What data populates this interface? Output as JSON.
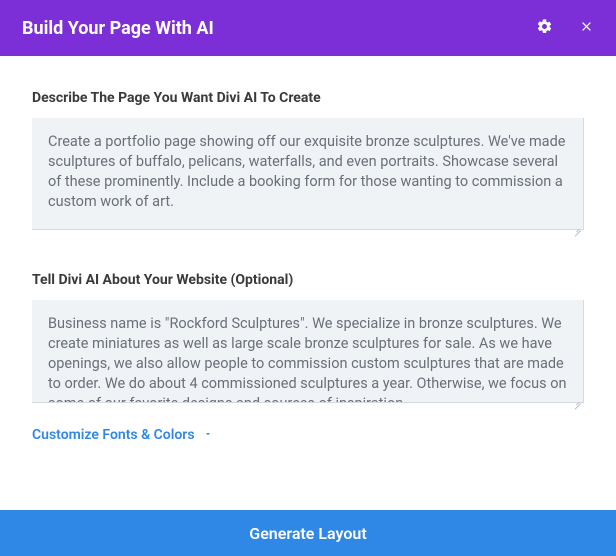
{
  "header": {
    "title": "Build Your Page With AI"
  },
  "describe": {
    "label": "Describe The Page You Want Divi AI To Create",
    "value": "Create a portfolio page showing off our exquisite bronze sculptures. We've made sculptures of buffalo, pelicans, waterfalls, and even portraits. Showcase several of these prominently. Include a booking form for those wanting to commission a custom work of art."
  },
  "about": {
    "label": "Tell Divi AI About Your Website (Optional)",
    "value": "Business name is \"Rockford Sculptures\". We specialize in bronze sculptures. We create miniatures as well as large scale bronze sculptures for sale. As we have openings, we also allow people to commission custom sculptures that are made to order. We do about 4 commissioned sculptures a year. Otherwise, we focus on some of our favorite designs and sources of inspiration."
  },
  "customize": {
    "label": "Customize Fonts & Colors"
  },
  "generate": {
    "label": "Generate Layout"
  }
}
